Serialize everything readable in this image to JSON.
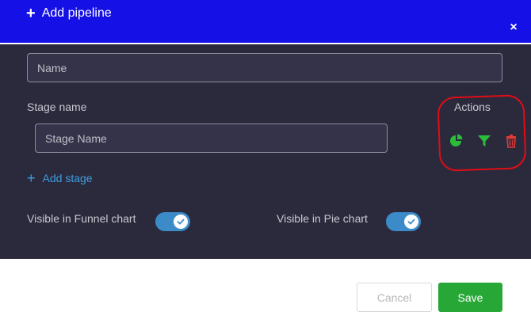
{
  "dialog": {
    "title": "Add pipeline",
    "title_icon": "plus",
    "close_icon": "×"
  },
  "form": {
    "name_placeholder": "Name",
    "stage_name_label": "Stage name",
    "stage_name_placeholder": "Stage Name",
    "actions_label": "Actions",
    "actions": [
      {
        "icon": "pie-chart-icon",
        "color": "#2bbd3a"
      },
      {
        "icon": "filter-icon",
        "color": "#2bbd3a"
      },
      {
        "icon": "trash-icon",
        "color": "#e53935"
      }
    ],
    "add_stage_label": "Add stage",
    "visible_funnel_label": "Visible in Funnel chart",
    "visible_funnel_on": true,
    "visible_pie_label": "Visible in Pie chart",
    "visible_pie_on": true
  },
  "footer": {
    "cancel_label": "Cancel",
    "save_label": "Save"
  },
  "colors": {
    "header": "#1410e6",
    "panel": "#2b2a3d",
    "toggle": "#3b8bc9",
    "link": "#3c9ee0",
    "save": "#27a836",
    "annotation": "#e10c16"
  }
}
